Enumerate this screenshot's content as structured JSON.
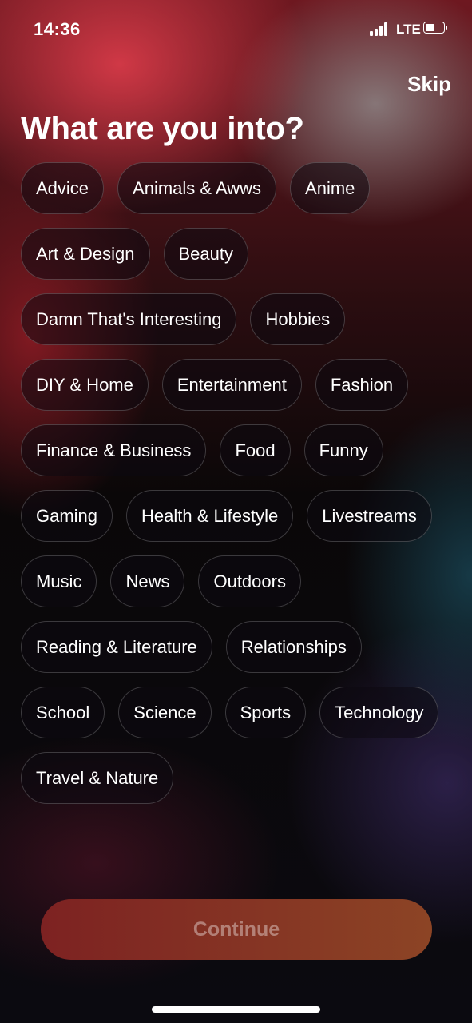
{
  "status_bar": {
    "time": "14:36",
    "network": "LTE",
    "signal_bars": 4,
    "battery_level": 0.4
  },
  "header": {
    "skip_label": "Skip",
    "title": "What are you into?"
  },
  "interests": [
    "Advice",
    "Animals & Awws",
    "Anime",
    "Art & Design",
    "Beauty",
    "Damn That's Interesting",
    "Hobbies",
    "DIY & Home",
    "Entertainment",
    "Fashion",
    "Finance & Business",
    "Food",
    "Funny",
    "Gaming",
    "Health & Lifestyle",
    "Livestreams",
    "Music",
    "News",
    "Outdoors",
    "Reading & Literature",
    "Relationships",
    "School",
    "Science",
    "Sports",
    "Technology",
    "Travel & Nature"
  ],
  "footer": {
    "continue_label": "Continue"
  }
}
